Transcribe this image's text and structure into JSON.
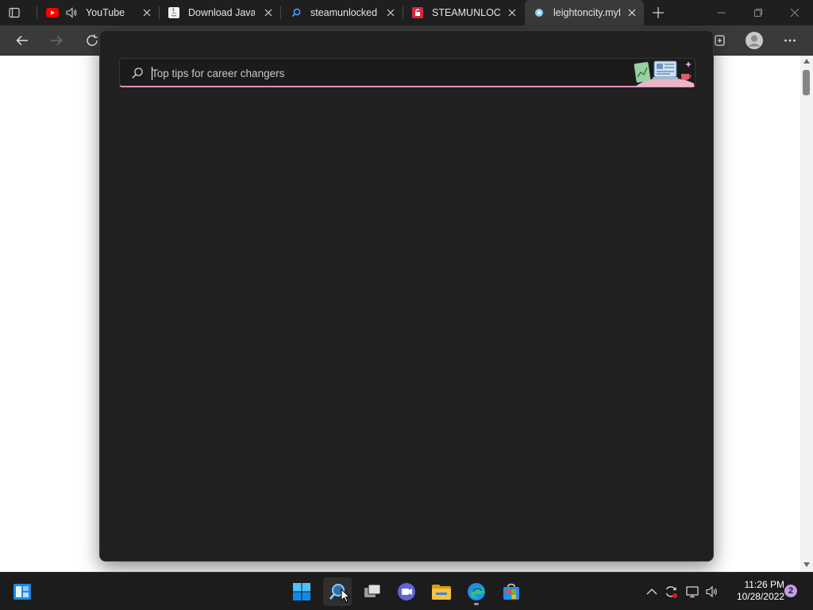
{
  "browser": {
    "tabs": [
      {
        "title": "YouTube",
        "favicon": "youtube-icon",
        "audio": true,
        "active": false
      },
      {
        "title": "Download Java f",
        "favicon": "java-icon",
        "active": false
      },
      {
        "title": "steamunlocked",
        "favicon": "search-icon",
        "active": false
      },
      {
        "title": "STEAMUNLOCKE",
        "favicon": "steamunlocked-icon",
        "active": false
      },
      {
        "title": "leightoncity.myf",
        "favicon": "site-icon",
        "active": true
      }
    ]
  },
  "search": {
    "placeholder": "Top tips for career changers",
    "value": ""
  },
  "taskbar": {
    "time": "11:26 PM",
    "date": "10/28/2022",
    "notification_count": "2"
  },
  "colors": {
    "flyout_bg": "#202020",
    "search_underline": "#e58fbd",
    "taskbar_bg": "#1c1c1c",
    "badge": "#c49be6"
  }
}
